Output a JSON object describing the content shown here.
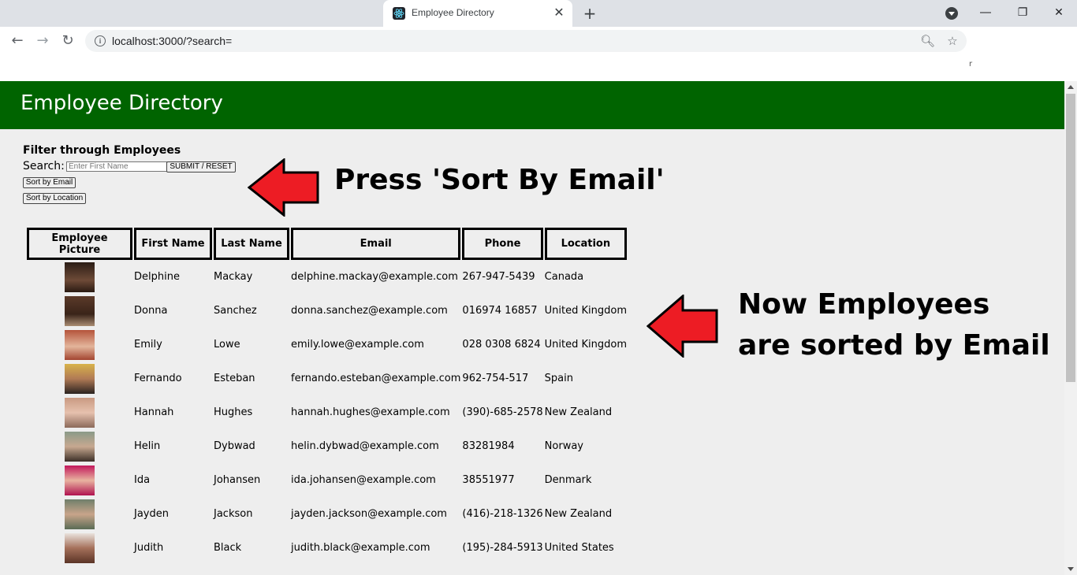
{
  "browser": {
    "tab_title": "Employee Directory",
    "url": "localhost:3000/?search=",
    "stray_text": "r"
  },
  "app": {
    "title": "Employee Directory",
    "header_color": "#006400"
  },
  "filter": {
    "heading": "Filter through Employees",
    "search_label": "Search:",
    "search_placeholder": "Enter First Name",
    "search_value": "",
    "submit_label": "SUBMIT / RESET",
    "sort_email_label": "Sort by Email",
    "sort_location_label": "Sort by Location"
  },
  "annotations": {
    "top": "Press 'Sort By Email'",
    "right_line1": "Now Employees",
    "right_line2": "are sorted by Email",
    "arrow_color": "#ed1c24"
  },
  "table": {
    "headers": [
      "Employee Picture",
      "First Name",
      "Last Name",
      "Email",
      "Phone",
      "Location"
    ],
    "rows": [
      {
        "first": "Delphine",
        "last": "Mackay",
        "email": "delphine.mackay@example.com",
        "phone": "267-947-5439",
        "location": "Canada"
      },
      {
        "first": "Donna",
        "last": "Sanchez",
        "email": "donna.sanchez@example.com",
        "phone": "016974 16857",
        "location": "United Kingdom"
      },
      {
        "first": "Emily",
        "last": "Lowe",
        "email": "emily.lowe@example.com",
        "phone": "028 0308 6824",
        "location": "United Kingdom"
      },
      {
        "first": "Fernando",
        "last": "Esteban",
        "email": "fernando.esteban@example.com",
        "phone": "962-754-517",
        "location": "Spain"
      },
      {
        "first": "Hannah",
        "last": "Hughes",
        "email": "hannah.hughes@example.com",
        "phone": "(390)-685-2578",
        "location": "New Zealand"
      },
      {
        "first": "Helin",
        "last": "Dybwad",
        "email": "helin.dybwad@example.com",
        "phone": "83281984",
        "location": "Norway"
      },
      {
        "first": "Ida",
        "last": "Johansen",
        "email": "ida.johansen@example.com",
        "phone": "38551977",
        "location": "Denmark"
      },
      {
        "first": "Jayden",
        "last": "Jackson",
        "email": "jayden.jackson@example.com",
        "phone": "(416)-218-1326",
        "location": "New Zealand"
      },
      {
        "first": "Judith",
        "last": "Black",
        "email": "judith.black@example.com",
        "phone": "(195)-284-5913",
        "location": "United States"
      }
    ]
  }
}
